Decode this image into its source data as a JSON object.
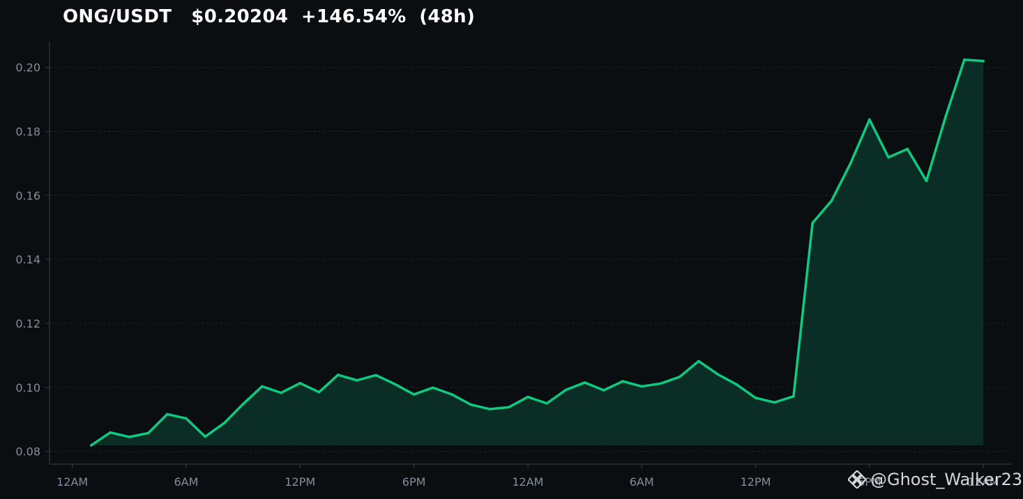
{
  "header": {
    "title": "ONG/USDT   $0.20204  +146.54%  (48h)"
  },
  "watermark": {
    "icon": "binance-logo-icon",
    "text": "@Ghost_Walker23"
  },
  "colors": {
    "background": "#0b0e11",
    "line": "#0ecb81",
    "fill": "#0a2e26",
    "grid": "#1e2329",
    "axis": "#2b3139",
    "tick_text": "#848e9c"
  },
  "chart_data": {
    "type": "area",
    "title": "ONG/USDT   $0.20204  +146.54%  (48h)",
    "xlabel": "",
    "ylabel": "",
    "x_unit": "hours",
    "x_range": [
      -1.2,
      49.5
    ],
    "ylim": [
      0.076,
      0.208
    ],
    "grid": "horizontal",
    "legend": "none",
    "y_ticks": [
      0.08,
      0.1,
      0.12,
      0.14,
      0.16,
      0.18,
      0.2
    ],
    "y_tick_labels": [
      "0.08",
      "0.10",
      "0.12",
      "0.14",
      "0.16",
      "0.18",
      "0.20"
    ],
    "x_ticks": [
      0,
      6,
      12,
      18,
      24,
      30,
      36,
      42,
      48
    ],
    "x_tick_labels": [
      "12AM",
      "6AM",
      "12PM",
      "6PM",
      "12AM",
      "6AM",
      "12PM",
      "6PM",
      "12AM"
    ],
    "series": [
      {
        "name": "",
        "x": [
          1,
          2,
          3,
          4,
          5,
          6,
          7,
          8,
          9,
          10,
          11,
          12,
          13,
          14,
          15,
          16,
          17,
          18,
          19,
          20,
          21,
          22,
          23,
          24,
          25,
          26,
          27,
          28,
          29,
          30,
          31,
          32,
          33,
          34,
          35,
          36,
          37,
          38,
          39,
          40,
          41,
          42,
          43,
          44,
          45,
          46,
          47,
          48
        ],
        "values": [
          0.0819,
          0.0859,
          0.0845,
          0.0857,
          0.0916,
          0.0903,
          0.0846,
          0.0888,
          0.0948,
          0.1003,
          0.0983,
          0.1013,
          0.0985,
          0.1039,
          0.1022,
          0.1038,
          0.101,
          0.0978,
          0.0999,
          0.0978,
          0.0946,
          0.0932,
          0.0938,
          0.097,
          0.095,
          0.0992,
          0.1015,
          0.0991,
          0.1019,
          0.1003,
          0.1012,
          0.1033,
          0.1082,
          0.1041,
          0.1009,
          0.0967,
          0.0953,
          0.0972,
          0.1514,
          0.1583,
          0.17,
          0.1837,
          0.1719,
          0.1745,
          0.1645,
          0.1844,
          0.2024,
          0.202
        ]
      }
    ]
  }
}
